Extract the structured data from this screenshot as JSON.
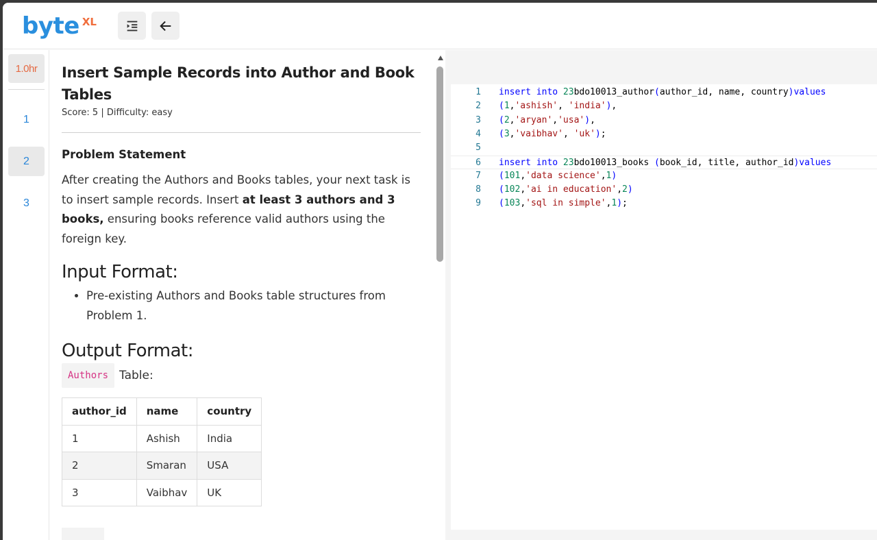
{
  "header": {
    "logo_main": "byte",
    "logo_sup": "XL",
    "toggle_icon": "indent-menu-icon",
    "back_icon": "arrow-left-icon"
  },
  "rail": {
    "timer": "1.0hr",
    "questions": [
      "1",
      "2",
      "3"
    ],
    "active_index": 1
  },
  "problem": {
    "title": "Insert Sample Records into Author and Book Tables",
    "meta": "Score: 5 | Difficulty: easy",
    "statement_heading": "Problem Statement",
    "statement_pre": "After creating the Authors and Books tables, your next task is to insert sample records. Insert ",
    "statement_bold": "at least 3 authors and 3 books,",
    "statement_post": " ensuring books reference valid authors using the foreign key.",
    "input_heading": "Input Format:",
    "input_bullet": "Pre-existing Authors and Books table structures from Problem 1.",
    "output_heading": "Output Format:",
    "authors_chip": "Authors",
    "authors_suffix": "Table:",
    "authors_table": {
      "headers": [
        "author_id",
        "name",
        "country"
      ],
      "rows": [
        [
          "1",
          "Ashish",
          "India"
        ],
        [
          "2",
          "Smaran",
          "USA"
        ],
        [
          "3",
          "Vaibhav",
          "UK"
        ]
      ]
    }
  },
  "editor": {
    "lines": [
      [
        [
          "k",
          "insert into "
        ],
        [
          "n",
          "23"
        ],
        [
          "t",
          "bdo10013_author"
        ],
        [
          "k",
          "("
        ],
        [
          "t",
          "author_id, name, country"
        ],
        [
          "k",
          ")values"
        ]
      ],
      [
        [
          "k",
          "("
        ],
        [
          "n",
          "1"
        ],
        [
          "t",
          ","
        ],
        [
          "s",
          "'ashish'"
        ],
        [
          "t",
          ", "
        ],
        [
          "s",
          "'india'"
        ],
        [
          "k",
          ")"
        ],
        [
          "t",
          ","
        ]
      ],
      [
        [
          "k",
          "("
        ],
        [
          "n",
          "2"
        ],
        [
          "t",
          ","
        ],
        [
          "s",
          "'aryan'"
        ],
        [
          "t",
          ","
        ],
        [
          "s",
          "'usa'"
        ],
        [
          "k",
          ")"
        ],
        [
          "t",
          ","
        ]
      ],
      [
        [
          "k",
          "("
        ],
        [
          "n",
          "3"
        ],
        [
          "t",
          ","
        ],
        [
          "s",
          "'vaibhav'"
        ],
        [
          "t",
          ", "
        ],
        [
          "s",
          "'uk'"
        ],
        [
          "k",
          ")"
        ],
        [
          "t",
          ";"
        ]
      ],
      [],
      [
        [
          "k",
          "insert into "
        ],
        [
          "n",
          "23"
        ],
        [
          "t",
          "bdo10013_books "
        ],
        [
          "k",
          "("
        ],
        [
          "t",
          "book_id, title, author_id"
        ],
        [
          "k",
          ")values"
        ]
      ],
      [
        [
          "k",
          "("
        ],
        [
          "n",
          "101"
        ],
        [
          "t",
          ","
        ],
        [
          "s",
          "'data science'"
        ],
        [
          "t",
          ","
        ],
        [
          "n",
          "1"
        ],
        [
          "k",
          ")"
        ]
      ],
      [
        [
          "k",
          "("
        ],
        [
          "n",
          "102"
        ],
        [
          "t",
          ","
        ],
        [
          "s",
          "'ai in education'"
        ],
        [
          "t",
          ","
        ],
        [
          "n",
          "2"
        ],
        [
          "k",
          ")"
        ]
      ],
      [
        [
          "k",
          "("
        ],
        [
          "n",
          "103"
        ],
        [
          "t",
          ","
        ],
        [
          "s",
          "'sql in simple'"
        ],
        [
          "t",
          ","
        ],
        [
          "n",
          "1"
        ],
        [
          "k",
          ")"
        ],
        [
          "t",
          ";"
        ]
      ]
    ],
    "current_line": 6
  }
}
